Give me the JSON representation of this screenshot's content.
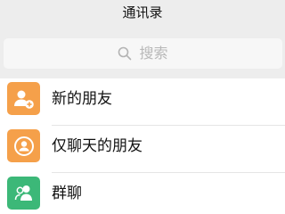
{
  "header": {
    "title": "通讯录"
  },
  "search": {
    "placeholder": "搜索",
    "icon": "search-icon"
  },
  "contacts_menu": {
    "items": [
      {
        "label": "新的朋友",
        "icon": "add-friend-icon",
        "color": "#f5a04a"
      },
      {
        "label": "仅聊天的朋友",
        "icon": "chat-only-friend-icon",
        "color": "#f5a04a"
      },
      {
        "label": "群聊",
        "icon": "group-chat-icon",
        "color": "#3cb878"
      }
    ]
  }
}
